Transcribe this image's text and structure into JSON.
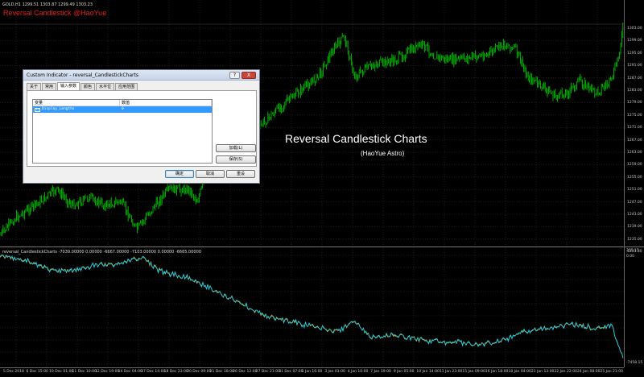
{
  "chart": {
    "symbol_line": "GOLD,H1  1299.51 1303.87 1299.49 1303.23",
    "indicator_name": "Reversal Candlestick @HaoYue",
    "overlay_title": "Reversal Candlestick Charts",
    "overlay_subtitle": "(HaoYue Astro)",
    "subwindow_line": "reversal_CandlestickCharts -7039.00000 0.00000 -6667.00000 -7103.00000 0.00000 -6665.00000",
    "price_axis": [
      "1303.00",
      "1299.00",
      "1295.00",
      "1291.00",
      "1287.00",
      "1283.00",
      "1279.00",
      "1275.00",
      "1271.00",
      "1267.00",
      "1263.00",
      "1259.00",
      "1255.00",
      "1251.00",
      "1247.00",
      "1243.00",
      "1239.00",
      "1235.00",
      "1231.30"
    ],
    "sub_axis_top": "255.15",
    "sub_axis_zero": "0.00",
    "sub_axis_bottom": "-7458.15",
    "time_axis": [
      "5 Dec 2018",
      "6 Dec 15:00",
      "10 Dec 01:00",
      "11 Dec 10:00",
      "12 Dec 19:00",
      "14 Dec 04:00",
      "17 Dec 14:00",
      "18 Dec 23:00",
      "20 Dec 09:00",
      "21 Dec 18:00",
      "26 Dec 12:00",
      "27 Dec 21:00",
      "31 Dec 07:00",
      "1 Jan 16:00",
      "3 Jan 01:00",
      "4 Jan 10:00",
      "7 Jan 19:00",
      "9 Jan 05:00",
      "10 Jan 14:00",
      "11 Jan 23:00",
      "15 Jan 09:00",
      "16 Jan 18:00",
      "18 Jan 04:00",
      "21 Jan 13:00",
      "22 Jan 22:00",
      "24 Jan 08:00",
      "25 Jan 21:00"
    ],
    "colors": {
      "bull": "#00c000",
      "bear": "#00c000",
      "line1": "#e8a020",
      "line2": "#00d8ff",
      "grid": "#3a3a3a"
    }
  },
  "dialog": {
    "title": "Custom Indicator - reversal_CandlestickCharts",
    "help_button": "?",
    "close_button": "X",
    "tabs": [
      "关于",
      "常用",
      "输入参数",
      "颜色",
      "水平位",
      "应用范围"
    ],
    "active_tab": 2,
    "columns": [
      "变量",
      "数值"
    ],
    "rows": [
      {
        "icon": "123",
        "name": "Display_Lengths",
        "value": "0"
      }
    ],
    "load_button": "加载(L)",
    "save_button": "保存(S)",
    "ok_button": "确定",
    "cancel_button": "取消",
    "reset_button": "重设"
  }
}
